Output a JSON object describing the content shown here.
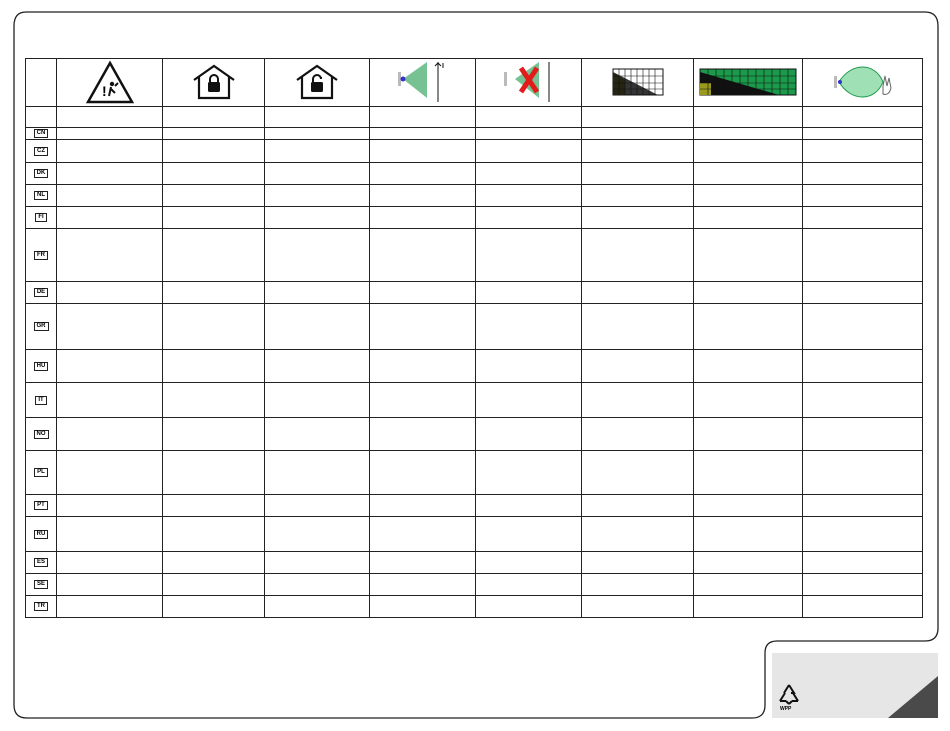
{
  "header_icons": [
    {
      "name": "warning-person-icon"
    },
    {
      "name": "locked-house-icon"
    },
    {
      "name": "unlocked-house-icon"
    },
    {
      "name": "sensor-detection-zone-icon"
    },
    {
      "name": "sensor-blocked-zone-icon"
    },
    {
      "name": "small-slope-chart-icon"
    },
    {
      "name": "wide-slope-chart-icon"
    },
    {
      "name": "sensor-lobe-hand-icon"
    }
  ],
  "rows": [
    {
      "code": "CN"
    },
    {
      "code": "CZ"
    },
    {
      "code": "DK"
    },
    {
      "code": "NL"
    },
    {
      "code": "FI"
    },
    {
      "code": "FR"
    },
    {
      "code": "DE"
    },
    {
      "code": "GR"
    },
    {
      "code": "HU"
    },
    {
      "code": "IT"
    },
    {
      "code": "NO"
    },
    {
      "code": "PL"
    },
    {
      "code": "PT"
    },
    {
      "code": "RU"
    },
    {
      "code": "ES"
    },
    {
      "code": "SE"
    },
    {
      "code": "TR"
    }
  ],
  "footer": {
    "recycle_label": "WPP"
  },
  "colors": {
    "line": "#222222",
    "green": "#1a9a4a",
    "olive": "#9a9a1e",
    "red": "#e21b1b",
    "corner_bg": "#e6e6e6",
    "corner_dark": "#4a4a4a"
  }
}
